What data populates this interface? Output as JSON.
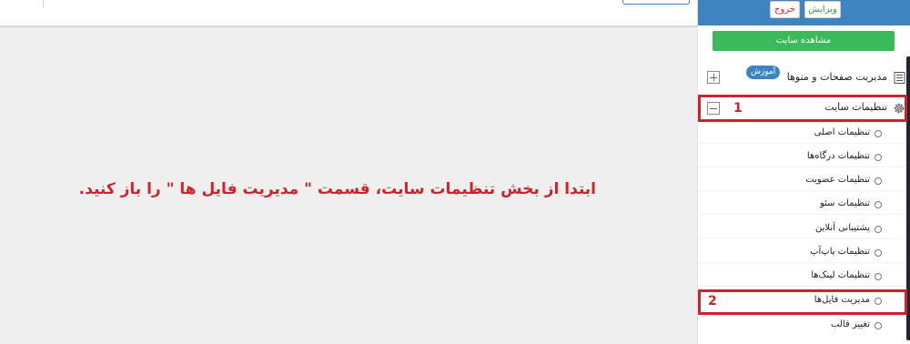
{
  "main": {
    "instruction": "ابتدا از بخش تنظیمات سایت، قسمت \" مدیریت فایل ها \" را باز کنید."
  },
  "sidebar": {
    "header": {
      "edit_label": "ویرایش",
      "exit_label": "خروج"
    },
    "view_site_label": "مشاهده سایت",
    "pages_menu": {
      "label": "مدیریت صفحات و منوها",
      "badge": "آموزش",
      "icon": "document-icon"
    },
    "site_settings": {
      "label": "تنظیمات سایت",
      "icon": "gear-icon",
      "items": [
        {
          "label": "تنظیمات اصلی"
        },
        {
          "label": "تنظیمات درگاه‌ها"
        },
        {
          "label": "تنظیمات عضویت"
        },
        {
          "label": "تنظیمات سئو"
        },
        {
          "label": "پشتیبانی آنلاین"
        },
        {
          "label": "تنظیمات پاپ‌آپ"
        },
        {
          "label": "تنظیمات لینک‌ها"
        },
        {
          "label": "مدیریت فایل‌ها"
        },
        {
          "label": "تغییر قالب"
        }
      ]
    }
  },
  "annotations": [
    {
      "number": "1",
      "color": "#d0222c"
    },
    {
      "number": "2",
      "color": "#d0222c"
    }
  ],
  "colors": {
    "accent": "#3e84c1",
    "success": "#3cb95a",
    "annotation": "#d0222c"
  }
}
